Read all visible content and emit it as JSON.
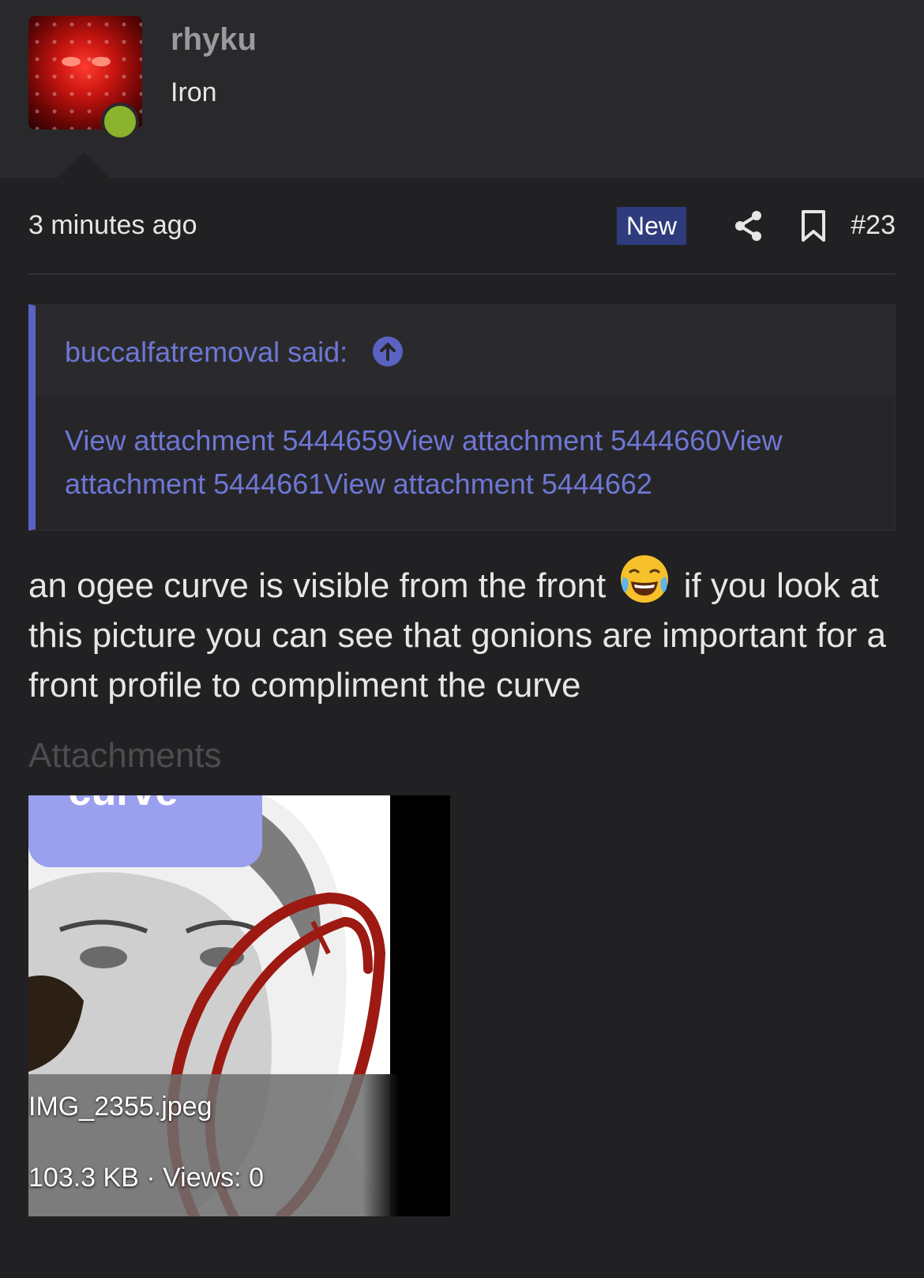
{
  "user": {
    "name": "rhyku",
    "title": "Iron",
    "online_status_color": "#8cb32d"
  },
  "post": {
    "timestamp": "3 minutes ago",
    "badge": "New",
    "number": "#23",
    "share_icon": "share-icon",
    "bookmark_icon": "bookmark-icon",
    "body_before_emoji": "an ogee curve is visible from the front",
    "emoji": "face-with-tears-of-joy",
    "body_after_emoji": "if you look at this picture you can see that gonions are important for a front profile to compliment the curve"
  },
  "quote": {
    "author": "buccalfatremoval said:",
    "jump_icon": "arrow-up-circle-icon",
    "text": "View attachment 5444659View attachment 5444660View attachment 5444661View attachment 5444662"
  },
  "attachments": {
    "heading": "Attachments",
    "items": [
      {
        "image_text": "curve",
        "filename": "IMG_2355.jpeg",
        "meta": "103.3 KB · Views: 0"
      }
    ]
  },
  "colors": {
    "background": "#212123",
    "header_background": "#29292c",
    "accent": "#6e77d4",
    "badge": "#2e3b7c"
  }
}
